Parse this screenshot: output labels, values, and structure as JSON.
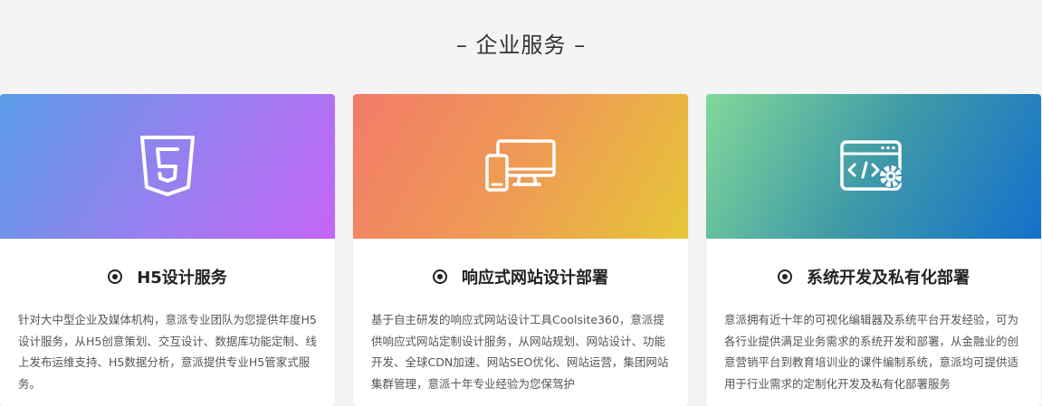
{
  "section": {
    "title": "– 企业服务 –"
  },
  "cards": [
    {
      "icon": "html5-icon",
      "title": "H5设计服务",
      "description": "针对大中型企业及媒体机构，意派专业团队为您提供年度H5设计服务，从H5创意策划、交互设计、数据库功能定制、线上发布运维支持、H5数据分析，意派提供专业H5管家式服务。"
    },
    {
      "icon": "devices-icon",
      "title": "响应式网站设计部署",
      "description": "基于自主研发的响应式网站设计工具Coolsite360，意派提供响应式网站定制设计服务，从网站规划、网站设计、功能开发、全球CDN加速、网站SEO优化、网站运营，集团网站集群管理，意派十年专业经验为您保驾护"
    },
    {
      "icon": "code-settings-icon",
      "title": "系统开发及私有化部署",
      "description": "意派拥有近十年的可视化编辑器及系统平台开发经验，可为各行业提供满足业务需求的系统开发和部署，从金融业的创意营销平台到教育培训业的课件编制系统，意派均可提供适用于行业需求的定制化开发及私有化部署服务"
    }
  ]
}
